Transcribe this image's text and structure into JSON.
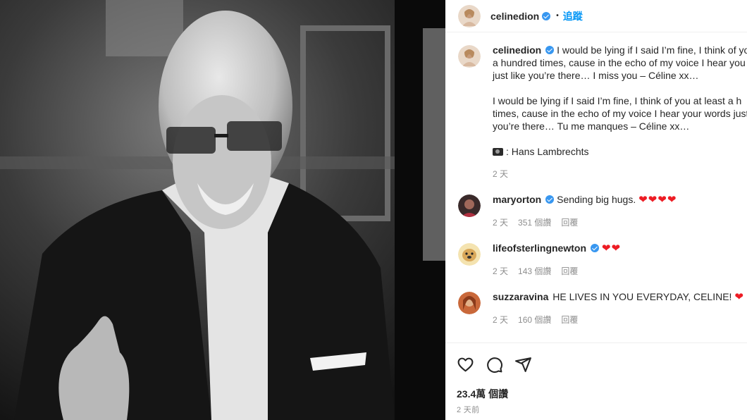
{
  "header": {
    "username": "celinedion",
    "dot": "•",
    "follow_label": "追蹤"
  },
  "caption": {
    "username": "celinedion",
    "lines": [
      "I would be lying if I said I’m fine, I think of you",
      "a hundred times, cause in the echo of my voice I hear you",
      "just like you’re there… I miss you – Céline xx…",
      "I would be lying if I said I’m fine, I think of you at least a h",
      "times, cause in the echo of my voice I hear your words just",
      "you’re there… Tu me manques – Céline xx…",
      ": Hans Lambrechts"
    ],
    "time": "2 天"
  },
  "comments": [
    {
      "username": "maryorton",
      "verified": true,
      "text": "Sending big hugs.",
      "hearts": "❤❤❤❤",
      "time": "2 天",
      "likes": "351 個讚",
      "reply": "回覆"
    },
    {
      "username": "lifeofsterlingnewton",
      "verified": true,
      "text": "",
      "hearts": "❤❤",
      "time": "2 天",
      "likes": "143 個讚",
      "reply": "回覆"
    },
    {
      "username": "suzzaravina",
      "verified": false,
      "text": "HE LIVES IN YOU EVERYDAY, CELINE!",
      "hearts": "❤",
      "time": "2 天",
      "likes": "160 個讚",
      "reply": "回覆"
    }
  ],
  "footer": {
    "likes": "23.4萬 個讚",
    "ago": "2 天前"
  },
  "icons": [
    "heart-outline-icon",
    "comment-icon",
    "share-icon",
    "camera-icon",
    "verified-badge-icon"
  ],
  "colors": {
    "follow": "#0095f6",
    "verified": "#3897f0",
    "heart": "#ed1c24",
    "muted": "#8e8e8e"
  }
}
